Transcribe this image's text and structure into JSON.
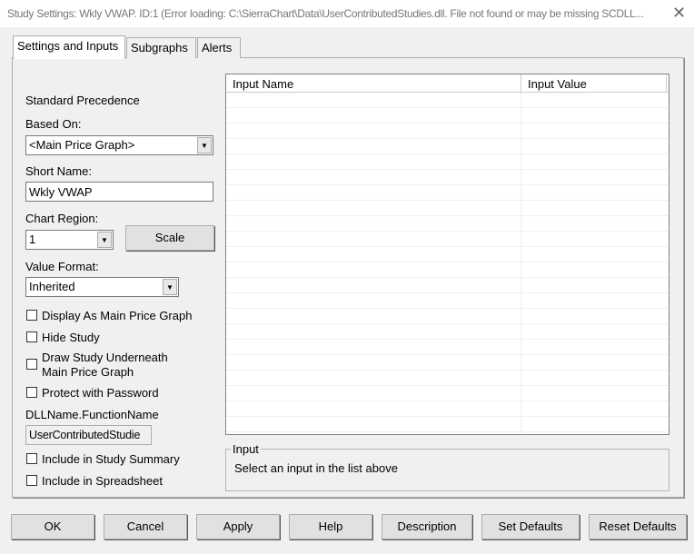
{
  "window": {
    "title": "Study Settings: Wkly VWAP. ID:1 (Error loading: C:\\SierraChart\\Data\\UserContributedStudies.dll. File not found or may be missing SCDLL...",
    "close_icon": "close-icon"
  },
  "tabs": [
    {
      "label": "Settings and Inputs",
      "active": true
    },
    {
      "label": "Subgraphs"
    },
    {
      "label": "Alerts"
    }
  ],
  "settings": {
    "precedence": "Standard Precedence",
    "based_on_label": "Based On:",
    "based_on_value": "<Main Price Graph>",
    "short_name_label": "Short Name:",
    "short_name_value": "Wkly VWAP",
    "chart_region_label": "Chart Region:",
    "chart_region_value": "1",
    "scale_button": "Scale",
    "value_format_label": "Value Format:",
    "value_format_value": "Inherited",
    "checkboxes": [
      {
        "label": "Display As Main Price Graph",
        "checked": false
      },
      {
        "label": "Hide Study",
        "checked": false
      },
      {
        "label": "Draw Study Underneath",
        "label2": "Main Price Graph",
        "checked": false
      },
      {
        "label": "Protect with Password",
        "checked": false
      }
    ],
    "dll_label": "DLLName.FunctionName",
    "dll_value": "UserContributedStudie",
    "checkboxes2": [
      {
        "label": "Include in Study Summary",
        "checked": false
      },
      {
        "label": "Include in Spreadsheet",
        "checked": false
      }
    ]
  },
  "grid": {
    "headers": [
      "Input Name",
      "Input Value"
    ]
  },
  "input_group": {
    "title": "Input",
    "text": "Select an input in the list above"
  },
  "buttons": {
    "ok": "OK",
    "cancel": "Cancel",
    "apply": "Apply",
    "help": "Help",
    "description": "Description",
    "set_defaults": "Set Defaults",
    "reset_defaults": "Reset Defaults"
  }
}
